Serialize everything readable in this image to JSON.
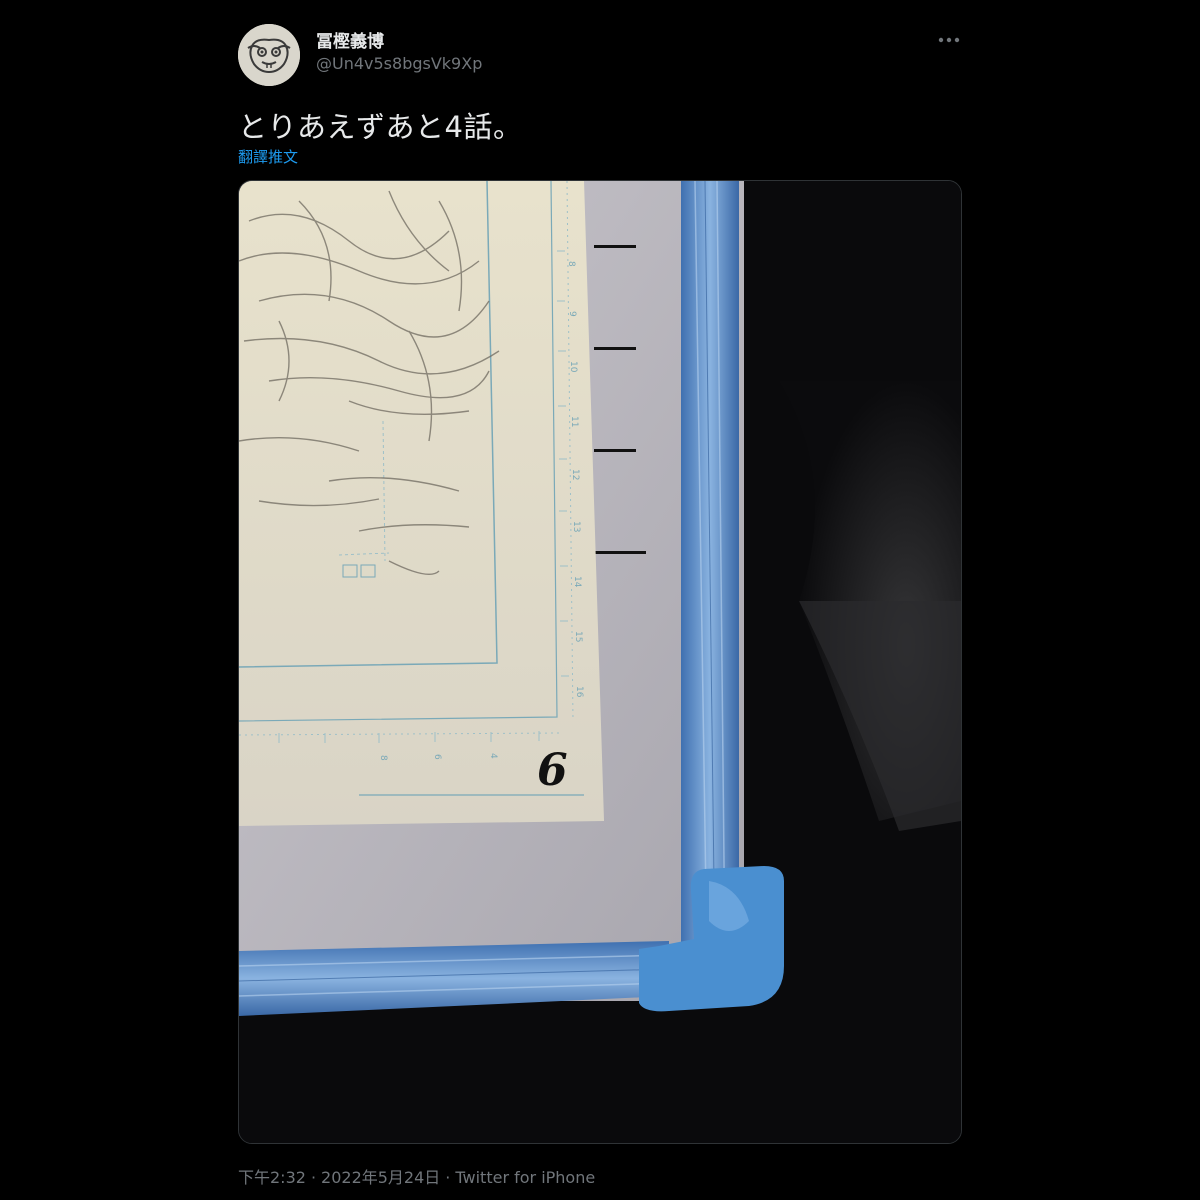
{
  "author": {
    "display_name": "冨樫義博",
    "handle": "@Un4v5s8bgsVk9Xp",
    "avatar_icon": "cartoon-face-avatar"
  },
  "tweet": {
    "text": "とりあえずあと4話。",
    "translate_label": "翻譯推文"
  },
  "photo": {
    "page_number_written": "6",
    "ruler_ticks_right": [
      "8",
      "9",
      "10",
      "11",
      "12",
      "13",
      "14",
      "15",
      "16"
    ],
    "ruler_ticks_bottom": [
      "8",
      "6",
      "4"
    ]
  },
  "meta": {
    "time": "下午2:32",
    "separator": "·",
    "date": "2022年5月24日",
    "source": "Twitter for iPhone"
  },
  "colors": {
    "background": "#000000",
    "text_primary": "#e7e9ea",
    "text_secondary": "#71767b",
    "link": "#1d9bf0",
    "frame_blue": "#5c8fc9",
    "corner_blue": "#4a8fd0"
  },
  "icons": {
    "more": "more-horizontal-icon"
  }
}
